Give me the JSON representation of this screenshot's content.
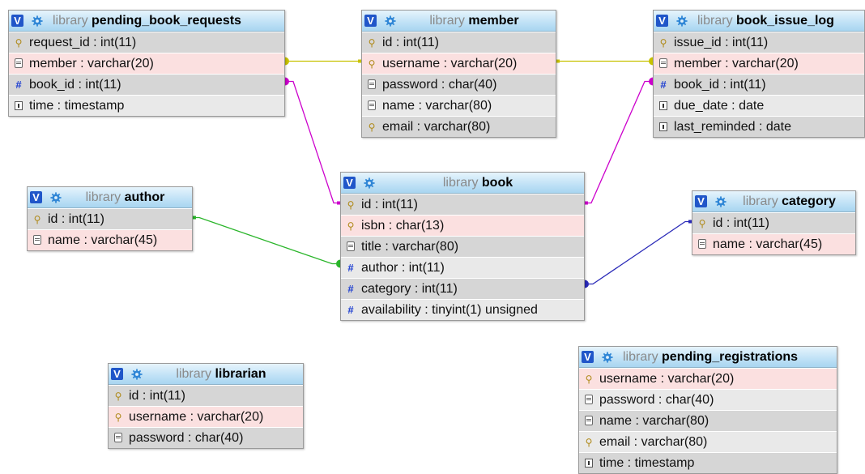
{
  "diagram": {
    "tables": [
      {
        "id": "pending_book_requests",
        "db": "library",
        "name": "pending_book_requests",
        "columns": [
          {
            "icon": "key-icon",
            "text": "request_id : int(11)"
          },
          {
            "icon": "text-icon",
            "text": "member : varchar(20)",
            "highlight": true
          },
          {
            "icon": "number-icon",
            "text": "book_id : int(11)"
          },
          {
            "icon": "date-icon",
            "text": "time : timestamp"
          }
        ]
      },
      {
        "id": "member",
        "db": "library",
        "name": "member",
        "columns": [
          {
            "icon": "key-icon",
            "text": "id : int(11)"
          },
          {
            "icon": "key-icon",
            "text": "username : varchar(20)",
            "highlight": true
          },
          {
            "icon": "text-icon",
            "text": "password : char(40)"
          },
          {
            "icon": "text-icon",
            "text": "name : varchar(80)"
          },
          {
            "icon": "key-icon",
            "text": "email : varchar(80)"
          }
        ]
      },
      {
        "id": "book_issue_log",
        "db": "library",
        "name": "book_issue_log",
        "columns": [
          {
            "icon": "key-icon",
            "text": "issue_id : int(11)"
          },
          {
            "icon": "text-icon",
            "text": "member : varchar(20)",
            "highlight": true
          },
          {
            "icon": "number-icon",
            "text": "book_id : int(11)"
          },
          {
            "icon": "date-icon",
            "text": "due_date : date"
          },
          {
            "icon": "date-icon",
            "text": "last_reminded : date"
          }
        ]
      },
      {
        "id": "author",
        "db": "library",
        "name": "author",
        "columns": [
          {
            "icon": "key-icon",
            "text": "id : int(11)"
          },
          {
            "icon": "text-icon",
            "text": "name : varchar(45)",
            "highlight": true
          }
        ]
      },
      {
        "id": "book",
        "db": "library",
        "name": "book",
        "columns": [
          {
            "icon": "key-icon",
            "text": "id : int(11)"
          },
          {
            "icon": "key-icon",
            "text": "isbn : char(13)",
            "highlight": true
          },
          {
            "icon": "text-icon",
            "text": "title : varchar(80)"
          },
          {
            "icon": "number-icon",
            "text": "author : int(11)"
          },
          {
            "icon": "number-icon",
            "text": "category : int(11)"
          },
          {
            "icon": "number-icon",
            "text": "availability : tinyint(1) unsigned"
          }
        ]
      },
      {
        "id": "category",
        "db": "library",
        "name": "category",
        "columns": [
          {
            "icon": "key-icon",
            "text": "id : int(11)"
          },
          {
            "icon": "text-icon",
            "text": "name : varchar(45)",
            "highlight": true
          }
        ]
      },
      {
        "id": "librarian",
        "db": "library",
        "name": "librarian",
        "columns": [
          {
            "icon": "key-icon",
            "text": "id : int(11)"
          },
          {
            "icon": "key-icon",
            "text": "username : varchar(20)",
            "highlight": true
          },
          {
            "icon": "text-icon",
            "text": "password : char(40)"
          }
        ]
      },
      {
        "id": "pending_registrations",
        "db": "library",
        "name": "pending_registrations",
        "columns": [
          {
            "icon": "key-icon",
            "text": "username : varchar(20)",
            "highlight": true
          },
          {
            "icon": "text-icon",
            "text": "password : char(40)"
          },
          {
            "icon": "text-icon",
            "text": "name : varchar(80)"
          },
          {
            "icon": "key-icon",
            "text": "email : varchar(80)"
          },
          {
            "icon": "date-icon",
            "text": "time : timestamp"
          }
        ]
      }
    ],
    "relations": [
      {
        "from": "pending_book_requests.member",
        "to": "member.username",
        "color": "#c8c200"
      },
      {
        "from": "book_issue_log.member",
        "to": "member.username",
        "color": "#c8c200"
      },
      {
        "from": "pending_book_requests.book_id",
        "to": "book.id",
        "color": "#cc00cc"
      },
      {
        "from": "book_issue_log.book_id",
        "to": "book.id",
        "color": "#cc00cc"
      },
      {
        "from": "book.author",
        "to": "author.id",
        "color": "#2ab52a"
      },
      {
        "from": "book.category",
        "to": "category.id",
        "color": "#2a2ab8"
      }
    ],
    "toggle_label": "V"
  }
}
